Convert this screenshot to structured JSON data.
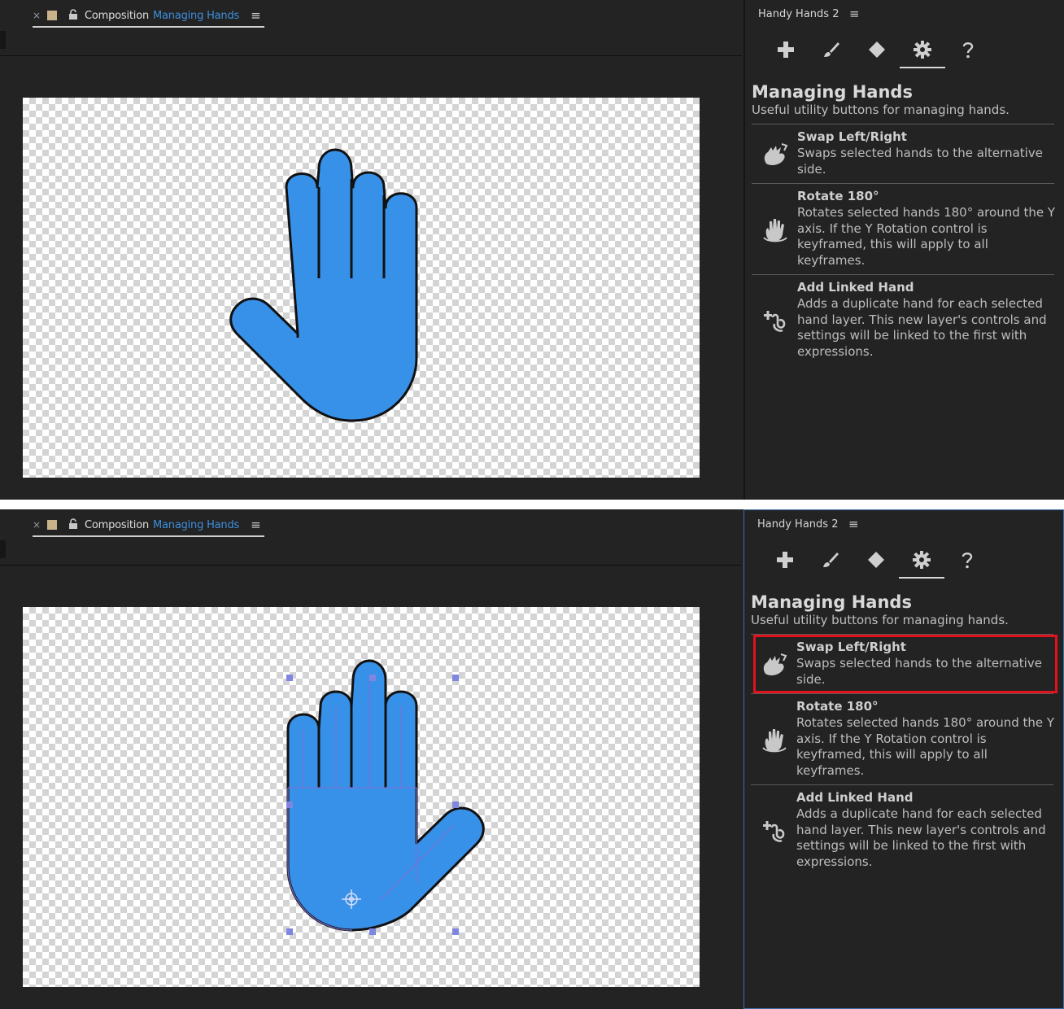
{
  "composition_tab": {
    "close": "×",
    "label": "Composition",
    "name": "Managing Hands",
    "menu": "≡"
  },
  "panel": {
    "title": "Handy Hands 2",
    "menu": "≡",
    "toolbar": [
      {
        "icon": "plus-icon"
      },
      {
        "icon": "brush-icon"
      },
      {
        "icon": "diamond-icon"
      },
      {
        "icon": "gear-icon",
        "active": true
      },
      {
        "icon": "question-icon"
      }
    ],
    "section_title": "Managing Hands",
    "section_subtitle": "Useful utility buttons for managing hands.",
    "items": [
      {
        "name": "Swap Left/Right",
        "description": "Swaps selected hands to the alternative side.",
        "icon": "swap-hands-icon"
      },
      {
        "name": "Rotate 180°",
        "description": "Rotates selected hands 180° around the Y axis. If the Y Rotation control is keyframed, this will apply to all keyframes.",
        "icon": "rotate-hand-icon"
      },
      {
        "name": "Add Linked Hand",
        "description": "Adds a duplicate hand for each selected hand layer. This new layer's controls and settings will be linked to the first with expressions.",
        "icon": "link-hand-icon"
      }
    ]
  },
  "colors": {
    "hand_fill": "#3891e8",
    "accent_blue": "#3e8fde",
    "highlight_red": "#e0121b"
  }
}
